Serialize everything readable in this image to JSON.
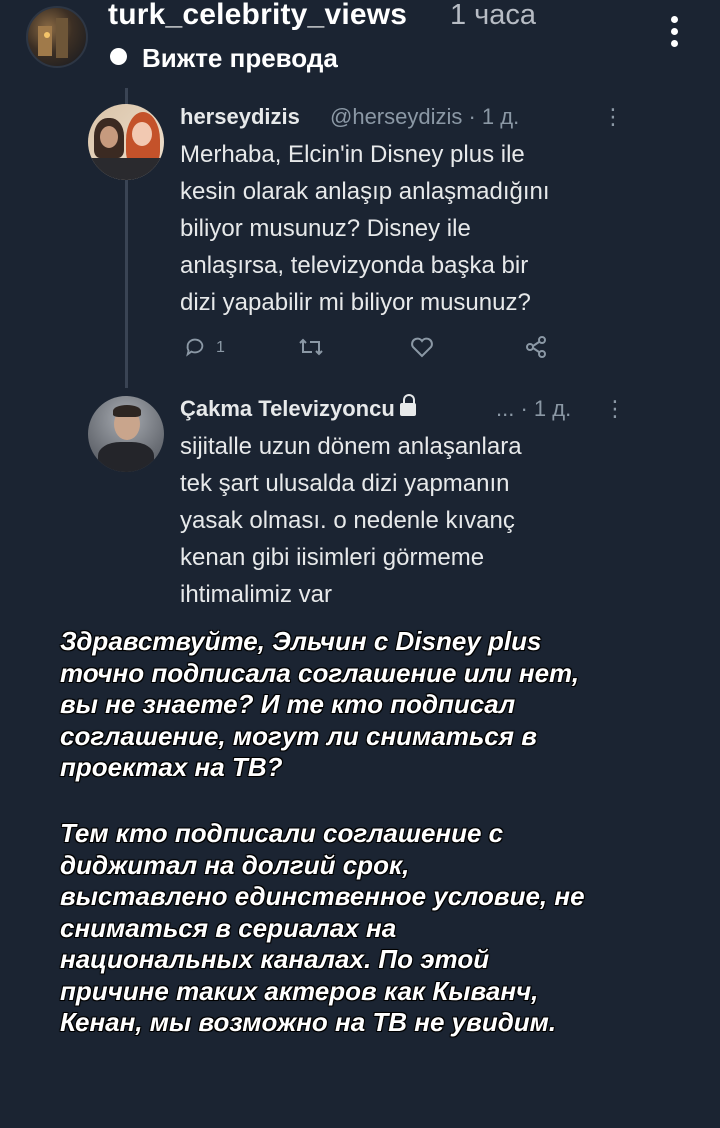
{
  "story": {
    "username": "turk_celebrity_views",
    "time": "1 часа",
    "translate_label": "Вижте превода",
    "more_icon": "vertical-dots-icon"
  },
  "tweets": [
    {
      "name": "herseydizis",
      "handle": "@herseydizis · 1 д.",
      "more": "⋮",
      "lines": [
        "Merhaba, Elcin'in Disney plus ile",
        "kesin olarak anlaşıp anlaşmadığını",
        "biliyor musunuz?  Disney ile",
        "anlaşırsa, televizyonda başka bir",
        "dizi yapabilir mi biliyor musunuz?"
      ],
      "actions": {
        "reply_icon": "reply-icon",
        "reply_count": "1",
        "retweet_icon": "retweet-icon",
        "like_icon": "heart-icon",
        "share_icon": "share-icon"
      }
    },
    {
      "name": "Çakma Televizyoncu",
      "lock_icon": "lock-icon",
      "handle": "... · 1 д.",
      "more": "⋮",
      "lines": [
        "sijitalle uzun dönem anlaşanlara",
        "tek şart ulusalda dizi yapmanın",
        "yasak olması. o nedenle kıvanç",
        "kenan gibi iisimleri görmeme",
        "ihtimalimiz var"
      ]
    }
  ],
  "caption": {
    "paragraph1": "Здравствуйте, Эльчин с Disney plus\nточно подписала соглашение или нет,\nвы не знаете? И те кто подписал\nсоглашение, могут ли сниматься в\nпроектах на ТВ?",
    "paragraph2": "Тем кто подписали соглашение с\nдиджитал на долгий срок,\nвыставлено единственное условие, не\nсниматься в сериалах на\nнациональных каналах. По этой\nпричине таких актеров как Кыванч,\nКенан, мы возможно на ТВ не увидим."
  }
}
